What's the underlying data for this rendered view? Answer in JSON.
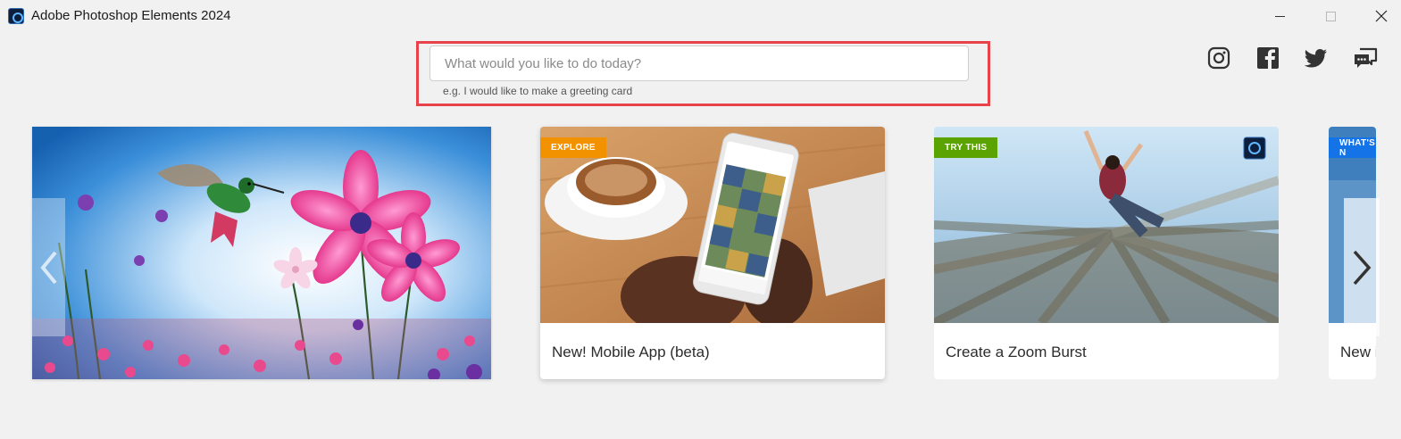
{
  "window": {
    "title": "Adobe Photoshop Elements 2024"
  },
  "search": {
    "placeholder": "What would you like to do today?",
    "hint": "e.g. I would like to make a greeting card",
    "highlight_color": "#e8434b"
  },
  "social": [
    "instagram-icon",
    "facebook-icon",
    "twitter-icon",
    "feedback-icon"
  ],
  "carousel": {
    "hero_image": "hummingbird-and-pink-cosmos-flowers",
    "cards": [
      {
        "badge": "EXPLORE",
        "badge_color": "#f39200",
        "title": "New! Mobile App (beta)",
        "image": "hands-holding-phone-with-coffee"
      },
      {
        "badge": "TRY THIS",
        "badge_color": "#5aa300",
        "title": "Create a Zoom Burst",
        "image": "man-jumping-zoom-burst"
      },
      {
        "badge": "WHAT'S N",
        "badge_color": "#1473e6",
        "title": "New i",
        "image": "blue-preview"
      }
    ]
  }
}
